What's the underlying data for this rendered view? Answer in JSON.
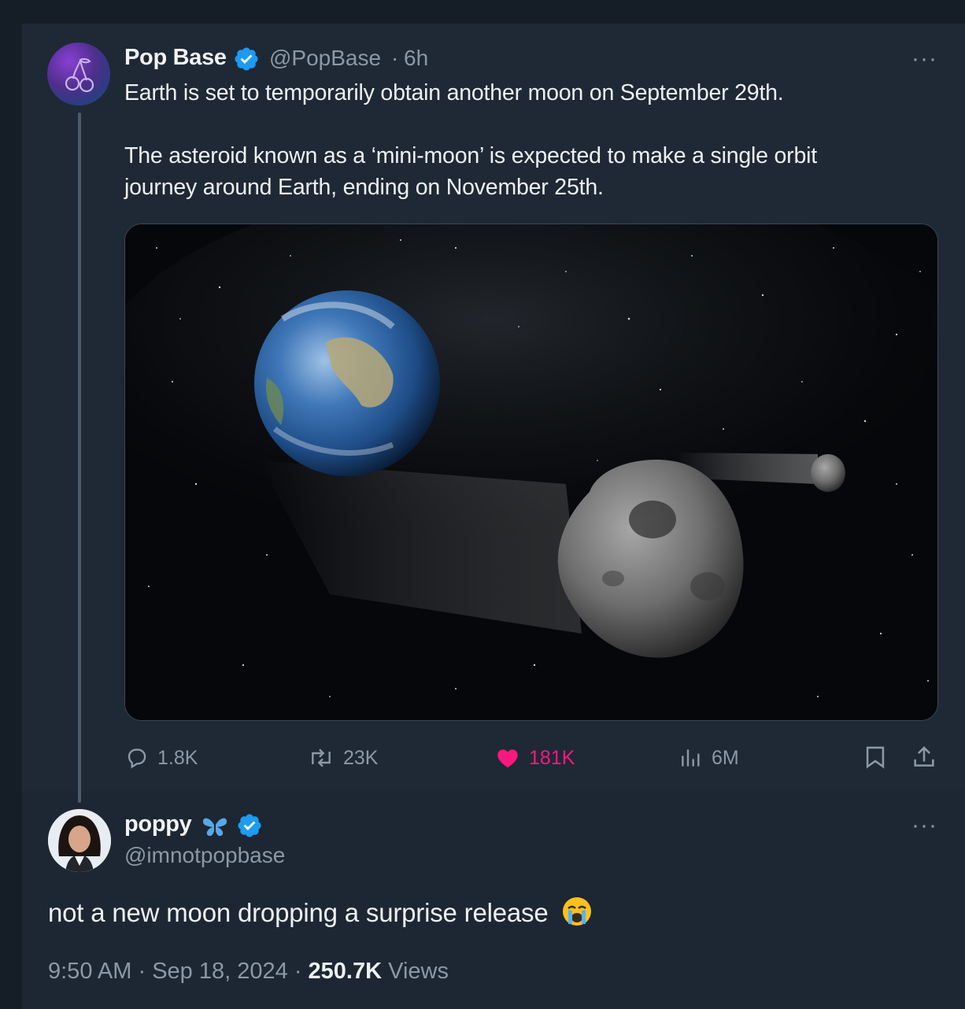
{
  "quoted_tweet": {
    "author": {
      "name": "Pop Base",
      "handle": "@PopBase",
      "time": "6h",
      "separator": "·",
      "verified": true,
      "avatar_icon": "cherry-icon"
    },
    "text_line_1": "Earth is set to temporarily obtain another moon on September 29th.",
    "text_line_2": "The asteroid known as a ‘mini-moon’ is expected to make a single orbit",
    "text_line_3": "journey around Earth, ending on November 25th.",
    "stats": {
      "replies": "1.8K",
      "retweets": "23K",
      "likes": "181K",
      "views": "6M"
    },
    "more_label": "···"
  },
  "main_tweet": {
    "author": {
      "name": "poppy",
      "emoji": "butterfly",
      "handle": "@imnotpopbase",
      "verified": true
    },
    "text": "not a new moon dropping a surprise release",
    "text_emoji": "loudly-crying-face",
    "time": "9:50 AM",
    "date": "Sep 18, 2024",
    "views_count": "250.7K",
    "views_label": "Views",
    "separator": "·",
    "more_label": "···"
  },
  "colors": {
    "background": "#151d26",
    "card": "#1e2935",
    "text": "#e7e9ea",
    "muted": "#8b98a5",
    "verified": "#1d9bf0",
    "like": "#f91880"
  }
}
